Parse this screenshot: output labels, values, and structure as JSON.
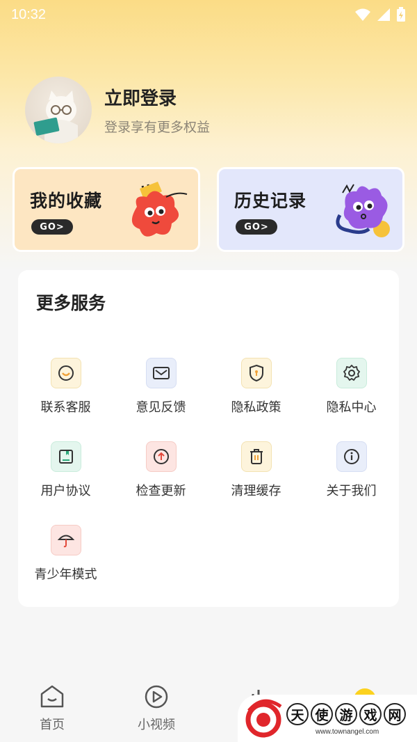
{
  "status_bar": {
    "time": "10:32"
  },
  "profile": {
    "login_title": "立即登录",
    "login_subtitle": "登录享有更多权益"
  },
  "cards": [
    {
      "title": "我的收藏",
      "go_label": "GO>"
    },
    {
      "title": "历史记录",
      "go_label": "GO>"
    }
  ],
  "services": {
    "title": "更多服务",
    "items": [
      {
        "label": "联系客服",
        "icon": "headset-icon"
      },
      {
        "label": "意见反馈",
        "icon": "mail-icon"
      },
      {
        "label": "隐私政策",
        "icon": "shield-icon"
      },
      {
        "label": "隐私中心",
        "icon": "gear-icon"
      },
      {
        "label": "用户协议",
        "icon": "book-icon"
      },
      {
        "label": "检查更新",
        "icon": "upload-icon"
      },
      {
        "label": "清理缓存",
        "icon": "trash-icon"
      },
      {
        "label": "关于我们",
        "icon": "info-icon"
      },
      {
        "label": "青少年模式",
        "icon": "umbrella-icon"
      }
    ]
  },
  "tabbar": {
    "items": [
      {
        "label": "首页",
        "icon": "home-icon"
      },
      {
        "label": "小视频",
        "icon": "play-icon"
      }
    ]
  },
  "watermark": {
    "chars": [
      "天",
      "使",
      "游",
      "戏",
      "网"
    ],
    "url": "www.townangel.com"
  }
}
